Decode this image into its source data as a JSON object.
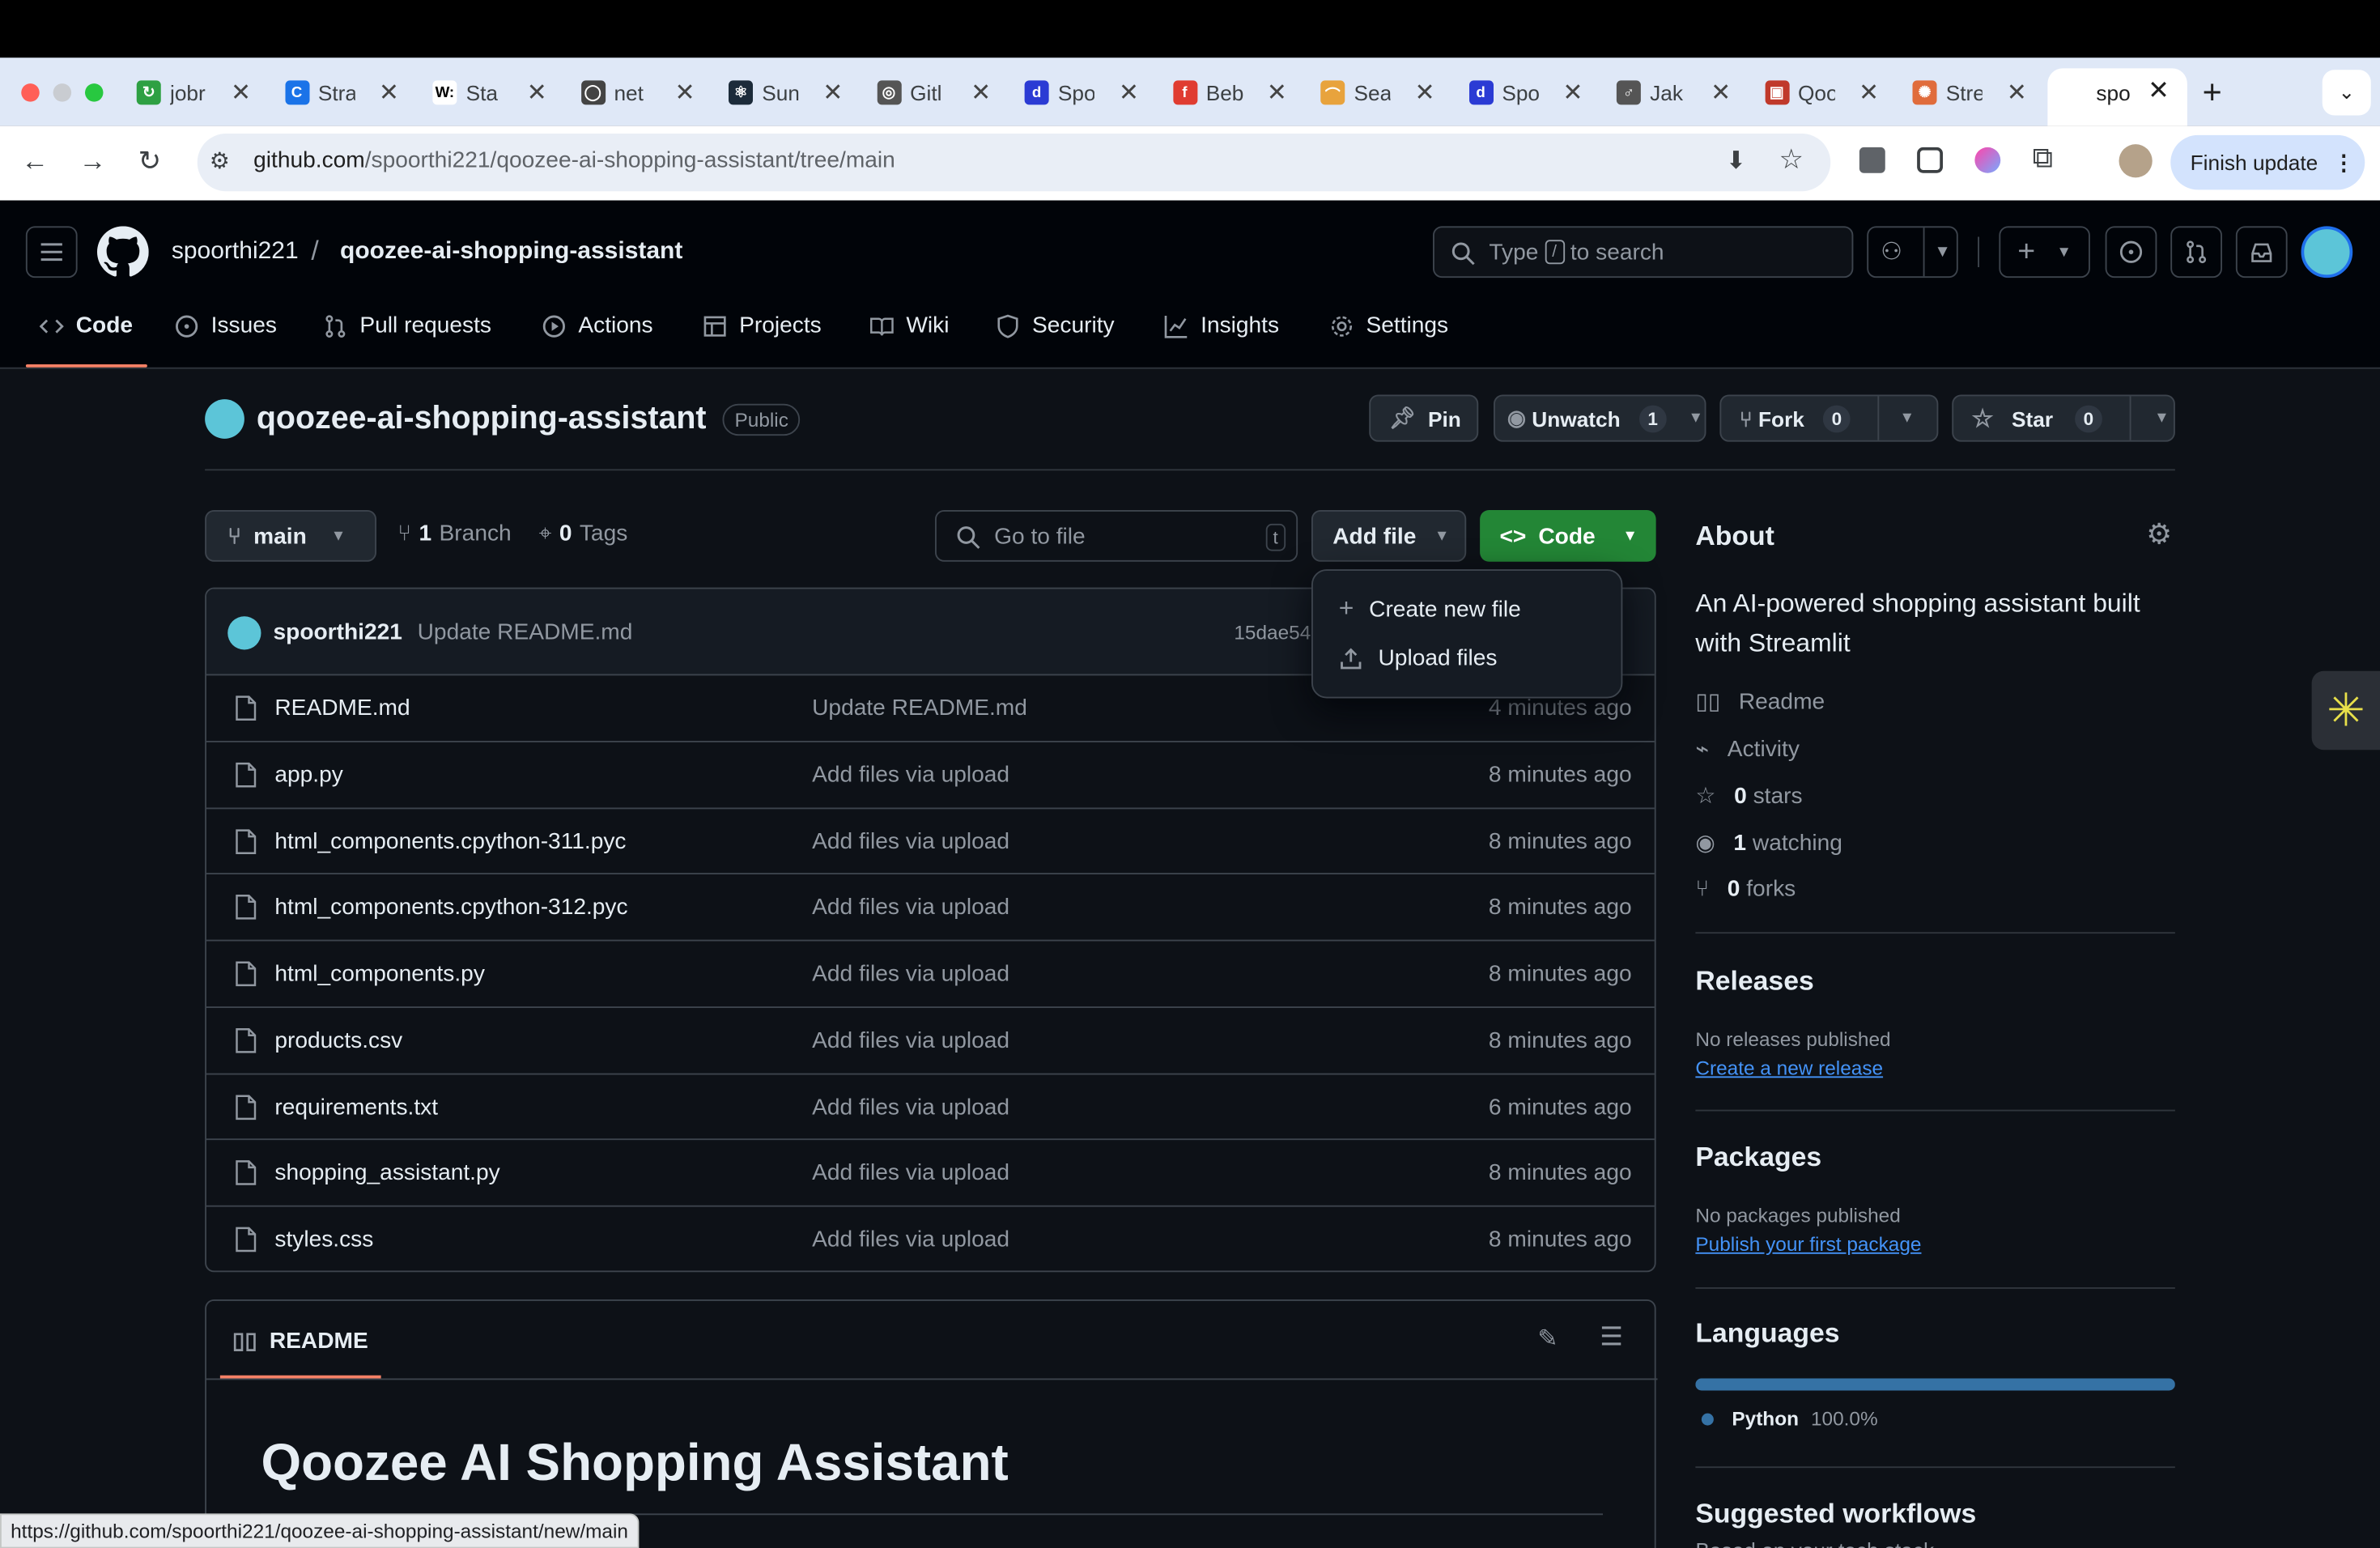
{
  "browser": {
    "tabs": [
      {
        "title": "jobr",
        "color": "#2ea043",
        "glyph": "↻"
      },
      {
        "title": "Stra",
        "color": "#1a73e8",
        "glyph": "C"
      },
      {
        "title": "Sta",
        "color": "#ffffff",
        "glyph": "W:"
      },
      {
        "title": "net",
        "color": "#444",
        "glyph": "◯"
      },
      {
        "title": "Sun",
        "color": "#1c2b3a",
        "glyph": "⚛"
      },
      {
        "title": "Gitl",
        "color": "#555",
        "glyph": "◎"
      },
      {
        "title": "Spo",
        "color": "#2b3bd4",
        "glyph": "d"
      },
      {
        "title": "Beb",
        "color": "#e03c31",
        "glyph": "f"
      },
      {
        "title": "Sea",
        "color": "#e8a33d",
        "glyph": "⌒"
      },
      {
        "title": "Spo",
        "color": "#2b3bd4",
        "glyph": "d"
      },
      {
        "title": "Jak",
        "color": "#555",
        "glyph": "♂"
      },
      {
        "title": "Qoo",
        "color": "#c0392b",
        "glyph": "▣"
      },
      {
        "title": "Stre",
        "color": "#e06c3c",
        "glyph": "✺"
      }
    ],
    "active_tab": {
      "title": "spo"
    },
    "url_host": "github.com",
    "url_path": "/spoorthi221/qoozee-ai-shopping-assistant/tree/main",
    "finish_update": "Finish update",
    "status_url": "https://github.com/spoorthi221/qoozee-ai-shopping-assistant/new/main"
  },
  "header": {
    "owner": "spoorthi221",
    "separator": "/",
    "repo": "qoozee-ai-shopping-assistant",
    "search_prefix": "Type",
    "search_key": "/",
    "search_suffix": "to search"
  },
  "nav": [
    {
      "label": "Code",
      "icon": "code-icon"
    },
    {
      "label": "Issues",
      "icon": "issue-icon"
    },
    {
      "label": "Pull requests",
      "icon": "pull-request-icon"
    },
    {
      "label": "Actions",
      "icon": "play-icon"
    },
    {
      "label": "Projects",
      "icon": "table-icon"
    },
    {
      "label": "Wiki",
      "icon": "book-icon"
    },
    {
      "label": "Security",
      "icon": "shield-icon"
    },
    {
      "label": "Insights",
      "icon": "graph-icon"
    },
    {
      "label": "Settings",
      "icon": "gear-icon"
    }
  ],
  "repo": {
    "title": "qoozee-ai-shopping-assistant",
    "visibility": "Public",
    "pin": "Pin",
    "unwatch": "Unwatch",
    "watch_count": "1",
    "fork": "Fork",
    "fork_count": "0",
    "star": "Star",
    "star_count": "0"
  },
  "toolbar": {
    "branch": "main",
    "branches_count": "1",
    "branches_label": "Branch",
    "tags_count": "0",
    "tags_label": "Tags",
    "goto_placeholder": "Go to file",
    "goto_key": "t",
    "add_file": "Add file",
    "code": "Code"
  },
  "add_file_menu": [
    {
      "label": "Create new file",
      "icon": "plus-icon"
    },
    {
      "label": "Upload files",
      "icon": "upload-icon"
    }
  ],
  "commit": {
    "author": "spoorthi221",
    "message": "Update README.md",
    "hash": "15dae54"
  },
  "files": [
    {
      "name": "README.md",
      "message": "Update README.md",
      "time": "4 minutes ago"
    },
    {
      "name": "app.py",
      "message": "Add files via upload",
      "time": "8 minutes ago"
    },
    {
      "name": "html_components.cpython-311.pyc",
      "message": "Add files via upload",
      "time": "8 minutes ago"
    },
    {
      "name": "html_components.cpython-312.pyc",
      "message": "Add files via upload",
      "time": "8 minutes ago"
    },
    {
      "name": "html_components.py",
      "message": "Add files via upload",
      "time": "8 minutes ago"
    },
    {
      "name": "products.csv",
      "message": "Add files via upload",
      "time": "8 minutes ago"
    },
    {
      "name": "requirements.txt",
      "message": "Add files via upload",
      "time": "6 minutes ago"
    },
    {
      "name": "shopping_assistant.py",
      "message": "Add files via upload",
      "time": "8 minutes ago"
    },
    {
      "name": "styles.css",
      "message": "Add files via upload",
      "time": "8 minutes ago"
    }
  ],
  "readme": {
    "tab": "README",
    "heading": "Qoozee AI Shopping Assistant"
  },
  "about": {
    "title": "About",
    "description_line1": "An AI-powered shopping assistant built",
    "description_line2": "with Streamlit",
    "readme": "Readme",
    "activity": "Activity",
    "stars_count": "0",
    "stars_label": "stars",
    "watching_count": "1",
    "watching_label": "watching",
    "forks_count": "0",
    "forks_label": "forks"
  },
  "releases": {
    "title": "Releases",
    "none": "No releases published",
    "create": "Create a new release"
  },
  "packages": {
    "title": "Packages",
    "none": "No packages published",
    "publish": "Publish your first package"
  },
  "languages": {
    "title": "Languages",
    "items": [
      {
        "name": "Python",
        "percent": "100.0%",
        "color": "#3572A5",
        "fraction": 1.0
      }
    ]
  },
  "workflows": {
    "title": "Suggested workflows",
    "subtitle": "Based on your tech stack"
  }
}
